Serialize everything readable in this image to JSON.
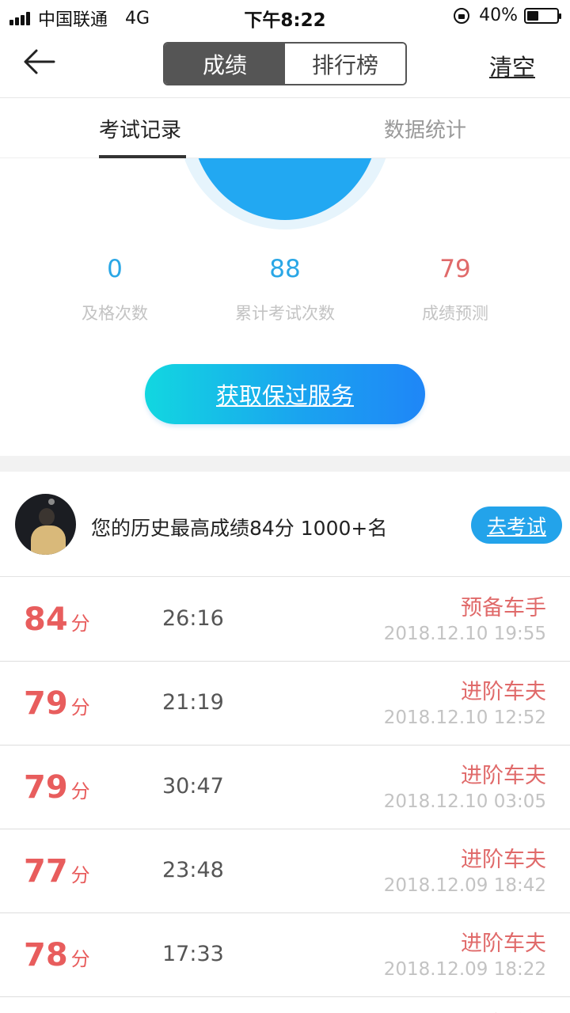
{
  "status_bar": {
    "carrier": "中国联通",
    "network": "4G",
    "time": "下午8:22",
    "battery": "40%",
    "battery_level": 0.4
  },
  "nav": {
    "back_icon": "back-arrow-icon",
    "segments": [
      "成绩",
      "排行榜"
    ],
    "active_segment": 0,
    "clear_label": "清空"
  },
  "tabs": {
    "items": [
      "考试记录",
      "数据统计"
    ],
    "active": 0
  },
  "stats": [
    {
      "value": "0",
      "label": "及格次数",
      "color": "#2aa7e6"
    },
    {
      "value": "88",
      "label": "累计考试次数",
      "color": "#2aa7e6"
    },
    {
      "value": "79",
      "label": "成绩预测",
      "color": "#e06a6a"
    }
  ],
  "service_button": "获取保过服务",
  "best": {
    "text": "您的历史最高成绩84分 1000+名",
    "go_exam_label": "去考试"
  },
  "records": [
    {
      "score": "84",
      "unit": "分",
      "duration": "26:16",
      "rank": "预备车手",
      "datetime": "2018.12.10 19:55"
    },
    {
      "score": "79",
      "unit": "分",
      "duration": "21:19",
      "rank": "进阶车夫",
      "datetime": "2018.12.10 12:52"
    },
    {
      "score": "79",
      "unit": "分",
      "duration": "30:47",
      "rank": "进阶车夫",
      "datetime": "2018.12.10 03:05"
    },
    {
      "score": "77",
      "unit": "分",
      "duration": "23:48",
      "rank": "进阶车夫",
      "datetime": "2018.12.09 18:42"
    },
    {
      "score": "78",
      "unit": "分",
      "duration": "17:33",
      "rank": "进阶车夫",
      "datetime": "2018.12.09 18:22"
    }
  ],
  "peek_rank": "已阶送手",
  "colors": {
    "accent_blue": "#23a3ea",
    "score_red": "#e85d5d",
    "gauge_blue": "#22a8f2"
  }
}
